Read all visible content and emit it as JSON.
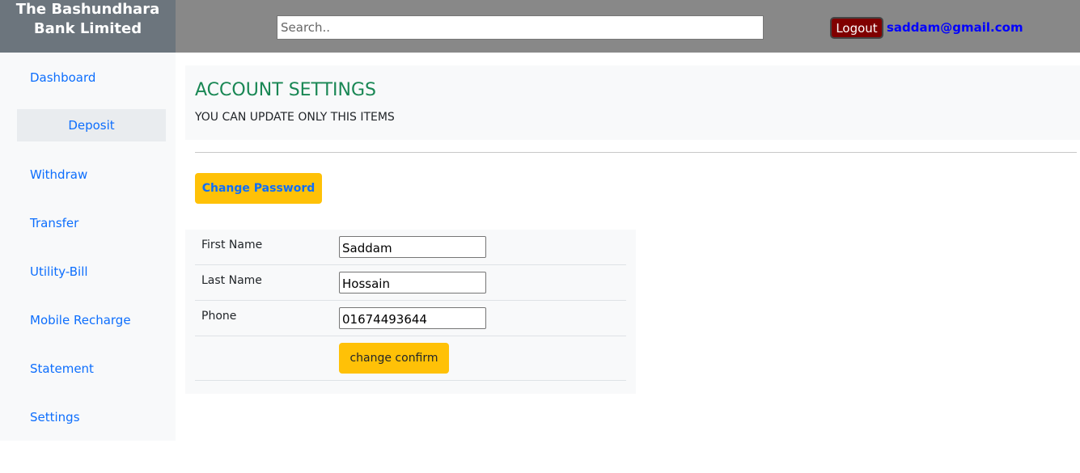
{
  "header": {
    "brand": "The Bashundhara Bank Limited",
    "search_placeholder": "Search..",
    "logout_label": "Logout",
    "user_email": "saddam@gmail.com"
  },
  "sidebar": {
    "items": [
      {
        "label": "Dashboard"
      },
      {
        "label": "Deposit",
        "active": true
      },
      {
        "label": "Withdraw"
      },
      {
        "label": "Transfer"
      },
      {
        "label": "Utility-Bill"
      },
      {
        "label": "Mobile Recharge"
      },
      {
        "label": "Statement"
      },
      {
        "label": "Settings"
      }
    ]
  },
  "main": {
    "title": "ACCOUNT SETTINGS",
    "subtitle": "YOU CAN UPDATE ONLY THIS ITEMS",
    "change_password_label": "Change Password",
    "form": {
      "rows": [
        {
          "label": "First Name",
          "value": "Saddam"
        },
        {
          "label": "Last Name",
          "value": "Hossain"
        },
        {
          "label": "Phone",
          "value": "01674493644"
        }
      ],
      "confirm_label": "change confirm"
    }
  },
  "colors": {
    "brand_bg": "#6c757d",
    "header_bg": "#888888",
    "logout_bg": "#800000",
    "title": "#198754",
    "accent": "#ffc107",
    "link": "#0d6efd"
  }
}
